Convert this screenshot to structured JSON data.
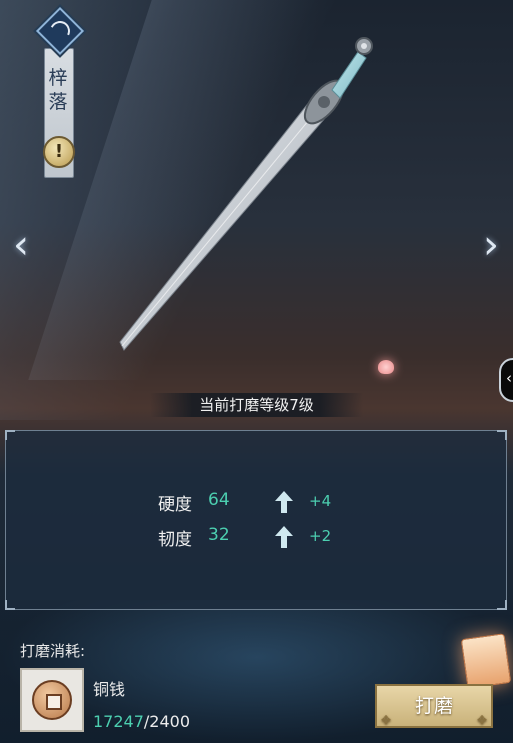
{
  "banner": {
    "name": "梓落",
    "alert": "!"
  },
  "navigation": {
    "prev": "‹",
    "next": "›",
    "side_tab": "‹"
  },
  "grind": {
    "level_label": "当前打磨等级7级"
  },
  "stats": [
    {
      "label": "硬度",
      "value": "64",
      "increase": "+4"
    },
    {
      "label": "韧度",
      "value": "32",
      "increase": "+2"
    }
  ],
  "cost": {
    "label": "打磨消耗:",
    "item_name": "铜钱",
    "owned": "17247",
    "required": "/2400"
  },
  "actions": {
    "grind_button": "打磨"
  },
  "colors": {
    "accent": "#4ccfb0",
    "button": "#c9b27a"
  },
  "icons": {
    "emblem": "crescent-moon-emblem",
    "alert": "exclamation-icon",
    "stat_increase": "up-arrow-icon",
    "cost_item": "copper-coin-icon",
    "weapon": "sword-illustration"
  }
}
